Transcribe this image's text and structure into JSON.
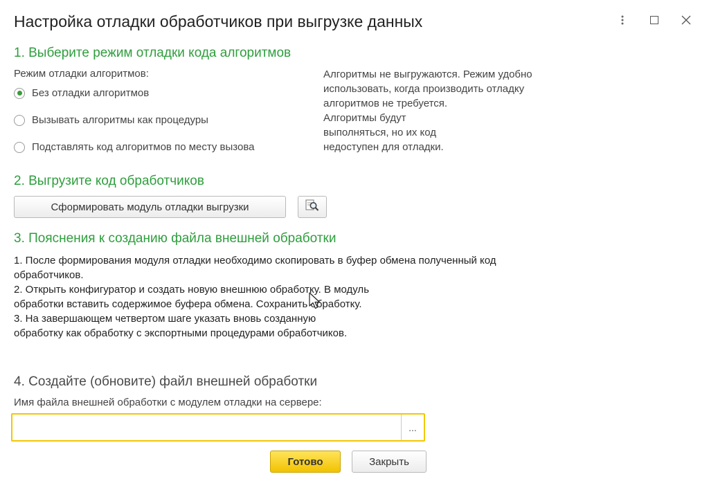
{
  "window": {
    "title": "Настройка отладки обработчиков при выгрузке данных"
  },
  "step1": {
    "heading": "1. Выберите режим отладки кода алгоритмов",
    "mode_label": "Режим отладки алгоритмов:",
    "options": [
      {
        "label": "Без отладки алгоритмов",
        "checked": true
      },
      {
        "label": "Вызывать алгоритмы как процедуры",
        "checked": false
      },
      {
        "label": "Подставлять код алгоритмов по месту вызова",
        "checked": false
      }
    ],
    "description": [
      "Алгоритмы не выгружаются. Режим удобно",
      "использовать, когда производить отладку",
      "алгоритмов не требуется.",
      "Алгоритмы будут",
      "выполняться, но их код",
      "недоступен для отладки."
    ]
  },
  "step2": {
    "heading": "2. Выгрузите код обработчиков",
    "generate_button": "Сформировать модуль отладки выгрузки"
  },
  "step3": {
    "heading": "3. Пояснения к созданию файла внешней обработки",
    "lines": [
      "1. После формирования модуля отладки необходимо скопировать в буфер обмена полученный код",
      "обработчиков.",
      "2. Открыть конфигуратор и создать новую внешнюю обработку. В модуль",
      "обработки вставить содержимое буфера обмена. Сохранить обработку.",
      "3. На завершающем четвертом шаге указать вновь созданную",
      "обработку как обработку с экспортными процедурами обработчиков."
    ]
  },
  "step4": {
    "heading": "4. Создайте (обновите) файл внешней обработки",
    "file_label": "Имя файла внешней обработки с модулем отладки на сервере:",
    "file_value": "",
    "choose_button": "..."
  },
  "footer": {
    "done_button": "Готово",
    "close_button": "Закрыть"
  },
  "colors": {
    "section_heading": "#2e9e3d",
    "primary_button": "#f5c800",
    "input_focus_border": "#f2c700"
  }
}
